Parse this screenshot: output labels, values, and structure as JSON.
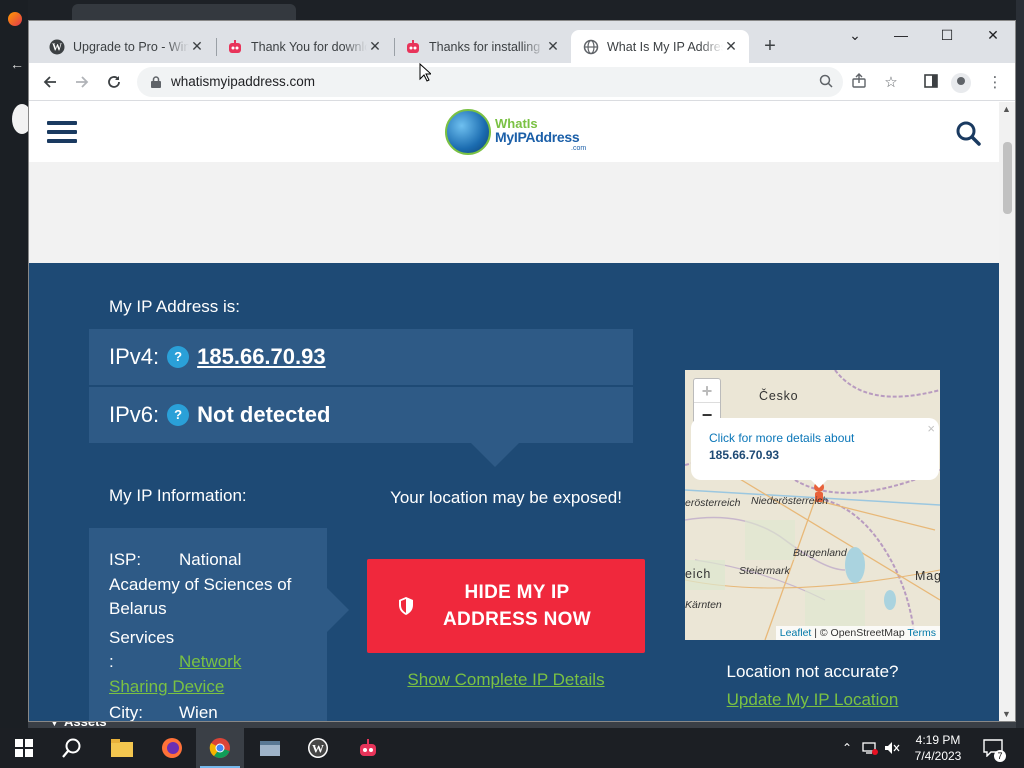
{
  "browser": {
    "tabs": [
      {
        "title": "Upgrade to Pro - Win",
        "icon": "wordpress-icon",
        "active": false
      },
      {
        "title": "Thank You for downlo",
        "icon": "robot-icon",
        "active": false
      },
      {
        "title": "Thanks for installing",
        "icon": "robot-icon",
        "active": false
      },
      {
        "title": "What Is My IP Addres",
        "icon": "globe-icon",
        "active": true
      }
    ],
    "url": "whatismyipaddress.com"
  },
  "site": {
    "logo_line1": "WhatIs",
    "logo_line2": "MyIPAddress",
    "logo_line3": ".com"
  },
  "ip_section": {
    "heading": "My IP Address is:",
    "ipv4_label": "IPv4:",
    "ipv4_value": "185.66.70.93",
    "ipv6_label": "IPv6:",
    "ipv6_value": "Not detected",
    "help_glyph": "?"
  },
  "info_section": {
    "heading": "My IP Information:",
    "isp_label": "ISP:",
    "isp_value": "National Academy of Sciences of Belarus",
    "services_label": "Services",
    "services_colon": ":",
    "services_value_1": "Network",
    "services_value_2": "Sharing Device",
    "city_label": "City:",
    "city_value": "Wien"
  },
  "cta": {
    "exposed_text": "Your location may be exposed!",
    "hide_button": "HIDE MY IP ADDRESS NOW",
    "details_link": "Show Complete IP Details"
  },
  "map": {
    "zoom_in": "+",
    "zoom_out": "−",
    "popup_text": "Click for more details about",
    "popup_ip": "185.66.70.93",
    "popup_close": "×",
    "labels": {
      "cesko": "Česko",
      "niederoesterreich": "Niederösterreich",
      "oberoesterreich": "erösterreich",
      "burgenland": "Burgenland",
      "steiermark": "Steiermark",
      "reich": "eich",
      "kaernten": "Kärnten",
      "mag": "Mag"
    },
    "attribution_leaflet": "Leaflet",
    "attribution_sep": " | © OpenStreetMap ",
    "attribution_terms": "Terms"
  },
  "location": {
    "question": "Location not accurate?",
    "update_link": "Update My IP Location"
  },
  "desktop": {
    "assets_label": "▼ Assets",
    "clock_time": "4:19 PM",
    "clock_date": "7/4/2023",
    "notification_count": "7"
  },
  "colors": {
    "page_blue": "#1e4a75",
    "box_blue": "#2e5a86",
    "accent_green": "#7ac143",
    "cta_red": "#f0283c"
  }
}
